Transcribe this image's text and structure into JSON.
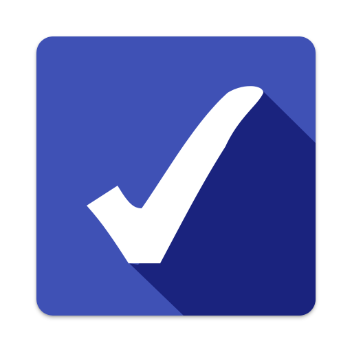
{
  "icon": {
    "name": "checkmark-icon",
    "colors": {
      "background": "#3f51b5",
      "long_shadow": "#1a237e",
      "checkmark": "#ffffff",
      "page": "#ffffff"
    }
  }
}
